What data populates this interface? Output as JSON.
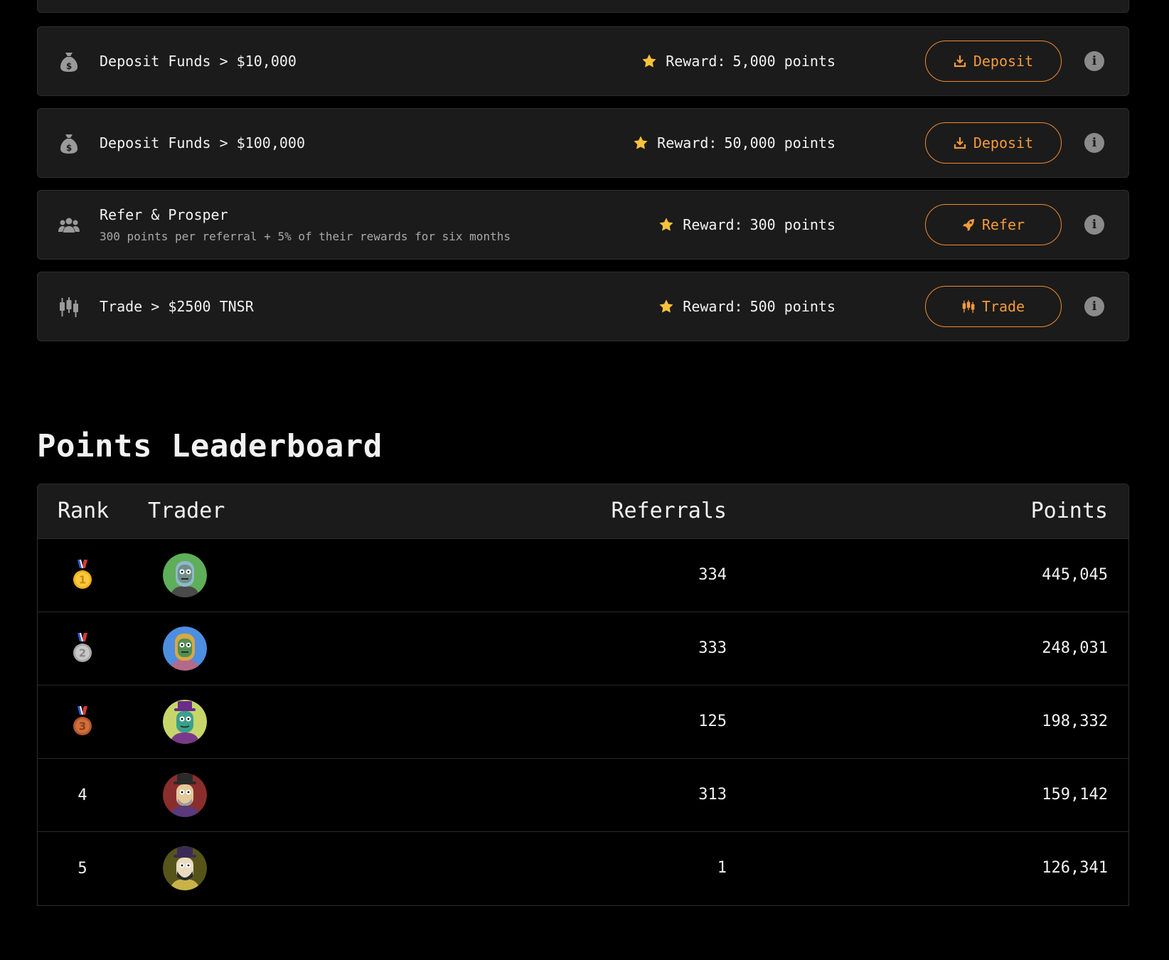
{
  "quests": [
    {
      "icon": "money-bag-icon",
      "title": "Deposit Funds > $10,000",
      "subtitle": "",
      "reward_label": "Reward:",
      "reward_value": "5,000 points",
      "button_icon": "download-icon",
      "button_label": "Deposit"
    },
    {
      "icon": "money-bag-icon",
      "title": "Deposit Funds > $100,000",
      "subtitle": "",
      "reward_label": "Reward:",
      "reward_value": "50,000 points",
      "button_icon": "download-icon",
      "button_label": "Deposit"
    },
    {
      "icon": "people-group-icon",
      "title": "Refer & Prosper",
      "subtitle": "300 points per referral + 5% of their rewards for six months",
      "reward_label": "Reward:",
      "reward_value": "300 points",
      "button_icon": "rocket-icon",
      "button_label": "Refer"
    },
    {
      "icon": "candlestick-chart-icon",
      "title": "Trade > $2500 TNSR",
      "subtitle": "",
      "reward_label": "Reward:",
      "reward_value": "500 points",
      "button_icon": "candlestick-chart-icon",
      "button_label": "Trade"
    }
  ],
  "leaderboard": {
    "title": "Points Leaderboard",
    "columns": {
      "rank": "Rank",
      "trader": "Trader",
      "referrals": "Referrals",
      "points": "Points"
    },
    "rows": [
      {
        "rank": "1",
        "rank_icon": "gold-medal-icon",
        "avatar_bg": "#5fae5a",
        "referrals": "334",
        "points": "445,045"
      },
      {
        "rank": "2",
        "rank_icon": "silver-medal-icon",
        "avatar_bg": "#4d8ee0",
        "referrals": "333",
        "points": "248,031"
      },
      {
        "rank": "3",
        "rank_icon": "bronze-medal-icon",
        "avatar_bg": "#c6d66a",
        "referrals": "125",
        "points": "198,332"
      },
      {
        "rank": "4",
        "rank_icon": "",
        "avatar_bg": "#8a2d2d",
        "referrals": "313",
        "points": "159,142"
      },
      {
        "rank": "5",
        "rank_icon": "",
        "avatar_bg": "#565419",
        "referrals": "1",
        "points": "126,341"
      }
    ]
  },
  "colors": {
    "accent": "#f08a2e",
    "card_bg": "#1b1b1b",
    "page_bg": "#000000",
    "star": "#f7c23b"
  }
}
